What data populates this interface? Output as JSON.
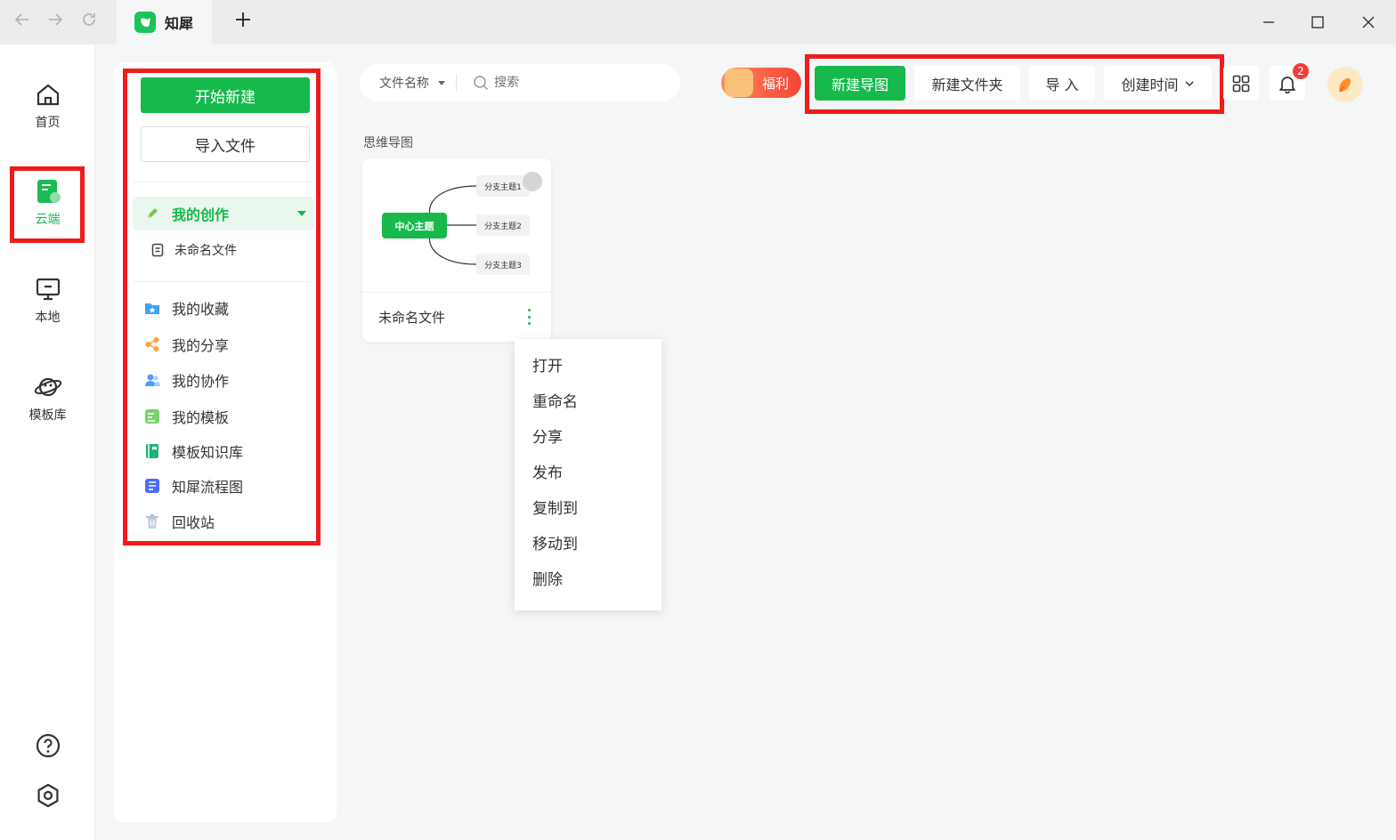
{
  "titlebar": {
    "tab_title": "知犀",
    "colors": {
      "brand": "#17b94c",
      "highlight": "#ee1c1c"
    }
  },
  "iconbar": {
    "items": [
      {
        "label": "首页",
        "icon": "home-icon"
      },
      {
        "label": "云端",
        "icon": "cloud-doc-icon",
        "active": true
      },
      {
        "label": "本地",
        "icon": "monitor-icon"
      },
      {
        "label": "模板库",
        "icon": "planet-icon"
      }
    ],
    "bottom": [
      {
        "icon": "help-icon"
      },
      {
        "icon": "settings-icon"
      }
    ]
  },
  "sidebar": {
    "new_label": "开始新建",
    "import_label": "导入文件",
    "mine_label": "我的创作",
    "mine_file": "未命名文件",
    "items": [
      {
        "label": "我的收藏",
        "icon": "favorite-folder-icon"
      },
      {
        "label": "我的分享",
        "icon": "share-icon"
      },
      {
        "label": "我的协作",
        "icon": "collaborate-icon"
      },
      {
        "label": "我的模板",
        "icon": "template-icon"
      },
      {
        "label": "模板知识库",
        "icon": "book-icon"
      },
      {
        "label": "知犀流程图",
        "icon": "flowchart-icon"
      },
      {
        "label": "回收站",
        "icon": "trash-icon"
      }
    ]
  },
  "toolbar": {
    "search_filter": "文件名称",
    "search_placeholder": "搜索",
    "welfare_label": "福利",
    "new_mindmap": "新建导图",
    "new_folder": "新建文件夹",
    "import": "导 入",
    "sort": "创建时间",
    "notification_count": "2"
  },
  "content": {
    "section_title": "思维导图",
    "card": {
      "name": "未命名文件",
      "thumb": {
        "center": "中心主题",
        "branches": [
          "分支主题1",
          "分支主题2",
          "分支主题3"
        ]
      }
    }
  },
  "context_menu": {
    "items": [
      "打开",
      "重命名",
      "分享",
      "发布",
      "复制到",
      "移动到",
      "删除"
    ]
  }
}
